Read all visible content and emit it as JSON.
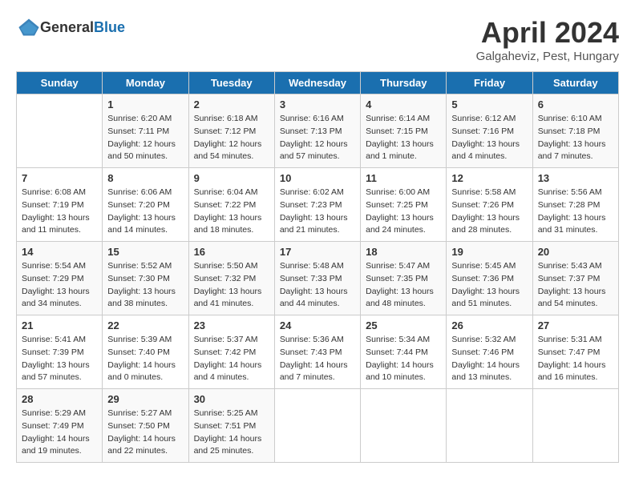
{
  "header": {
    "logo_general": "General",
    "logo_blue": "Blue",
    "month_title": "April 2024",
    "location": "Galgaheviz, Pest, Hungary"
  },
  "weekdays": [
    "Sunday",
    "Monday",
    "Tuesday",
    "Wednesday",
    "Thursday",
    "Friday",
    "Saturday"
  ],
  "weeks": [
    [
      {
        "day": "",
        "info": ""
      },
      {
        "day": "1",
        "info": "Sunrise: 6:20 AM\nSunset: 7:11 PM\nDaylight: 12 hours\nand 50 minutes."
      },
      {
        "day": "2",
        "info": "Sunrise: 6:18 AM\nSunset: 7:12 PM\nDaylight: 12 hours\nand 54 minutes."
      },
      {
        "day": "3",
        "info": "Sunrise: 6:16 AM\nSunset: 7:13 PM\nDaylight: 12 hours\nand 57 minutes."
      },
      {
        "day": "4",
        "info": "Sunrise: 6:14 AM\nSunset: 7:15 PM\nDaylight: 13 hours\nand 1 minute."
      },
      {
        "day": "5",
        "info": "Sunrise: 6:12 AM\nSunset: 7:16 PM\nDaylight: 13 hours\nand 4 minutes."
      },
      {
        "day": "6",
        "info": "Sunrise: 6:10 AM\nSunset: 7:18 PM\nDaylight: 13 hours\nand 7 minutes."
      }
    ],
    [
      {
        "day": "7",
        "info": "Sunrise: 6:08 AM\nSunset: 7:19 PM\nDaylight: 13 hours\nand 11 minutes."
      },
      {
        "day": "8",
        "info": "Sunrise: 6:06 AM\nSunset: 7:20 PM\nDaylight: 13 hours\nand 14 minutes."
      },
      {
        "day": "9",
        "info": "Sunrise: 6:04 AM\nSunset: 7:22 PM\nDaylight: 13 hours\nand 18 minutes."
      },
      {
        "day": "10",
        "info": "Sunrise: 6:02 AM\nSunset: 7:23 PM\nDaylight: 13 hours\nand 21 minutes."
      },
      {
        "day": "11",
        "info": "Sunrise: 6:00 AM\nSunset: 7:25 PM\nDaylight: 13 hours\nand 24 minutes."
      },
      {
        "day": "12",
        "info": "Sunrise: 5:58 AM\nSunset: 7:26 PM\nDaylight: 13 hours\nand 28 minutes."
      },
      {
        "day": "13",
        "info": "Sunrise: 5:56 AM\nSunset: 7:28 PM\nDaylight: 13 hours\nand 31 minutes."
      }
    ],
    [
      {
        "day": "14",
        "info": "Sunrise: 5:54 AM\nSunset: 7:29 PM\nDaylight: 13 hours\nand 34 minutes."
      },
      {
        "day": "15",
        "info": "Sunrise: 5:52 AM\nSunset: 7:30 PM\nDaylight: 13 hours\nand 38 minutes."
      },
      {
        "day": "16",
        "info": "Sunrise: 5:50 AM\nSunset: 7:32 PM\nDaylight: 13 hours\nand 41 minutes."
      },
      {
        "day": "17",
        "info": "Sunrise: 5:48 AM\nSunset: 7:33 PM\nDaylight: 13 hours\nand 44 minutes."
      },
      {
        "day": "18",
        "info": "Sunrise: 5:47 AM\nSunset: 7:35 PM\nDaylight: 13 hours\nand 48 minutes."
      },
      {
        "day": "19",
        "info": "Sunrise: 5:45 AM\nSunset: 7:36 PM\nDaylight: 13 hours\nand 51 minutes."
      },
      {
        "day": "20",
        "info": "Sunrise: 5:43 AM\nSunset: 7:37 PM\nDaylight: 13 hours\nand 54 minutes."
      }
    ],
    [
      {
        "day": "21",
        "info": "Sunrise: 5:41 AM\nSunset: 7:39 PM\nDaylight: 13 hours\nand 57 minutes."
      },
      {
        "day": "22",
        "info": "Sunrise: 5:39 AM\nSunset: 7:40 PM\nDaylight: 14 hours\nand 0 minutes."
      },
      {
        "day": "23",
        "info": "Sunrise: 5:37 AM\nSunset: 7:42 PM\nDaylight: 14 hours\nand 4 minutes."
      },
      {
        "day": "24",
        "info": "Sunrise: 5:36 AM\nSunset: 7:43 PM\nDaylight: 14 hours\nand 7 minutes."
      },
      {
        "day": "25",
        "info": "Sunrise: 5:34 AM\nSunset: 7:44 PM\nDaylight: 14 hours\nand 10 minutes."
      },
      {
        "day": "26",
        "info": "Sunrise: 5:32 AM\nSunset: 7:46 PM\nDaylight: 14 hours\nand 13 minutes."
      },
      {
        "day": "27",
        "info": "Sunrise: 5:31 AM\nSunset: 7:47 PM\nDaylight: 14 hours\nand 16 minutes."
      }
    ],
    [
      {
        "day": "28",
        "info": "Sunrise: 5:29 AM\nSunset: 7:49 PM\nDaylight: 14 hours\nand 19 minutes."
      },
      {
        "day": "29",
        "info": "Sunrise: 5:27 AM\nSunset: 7:50 PM\nDaylight: 14 hours\nand 22 minutes."
      },
      {
        "day": "30",
        "info": "Sunrise: 5:25 AM\nSunset: 7:51 PM\nDaylight: 14 hours\nand 25 minutes."
      },
      {
        "day": "",
        "info": ""
      },
      {
        "day": "",
        "info": ""
      },
      {
        "day": "",
        "info": ""
      },
      {
        "day": "",
        "info": ""
      }
    ]
  ]
}
